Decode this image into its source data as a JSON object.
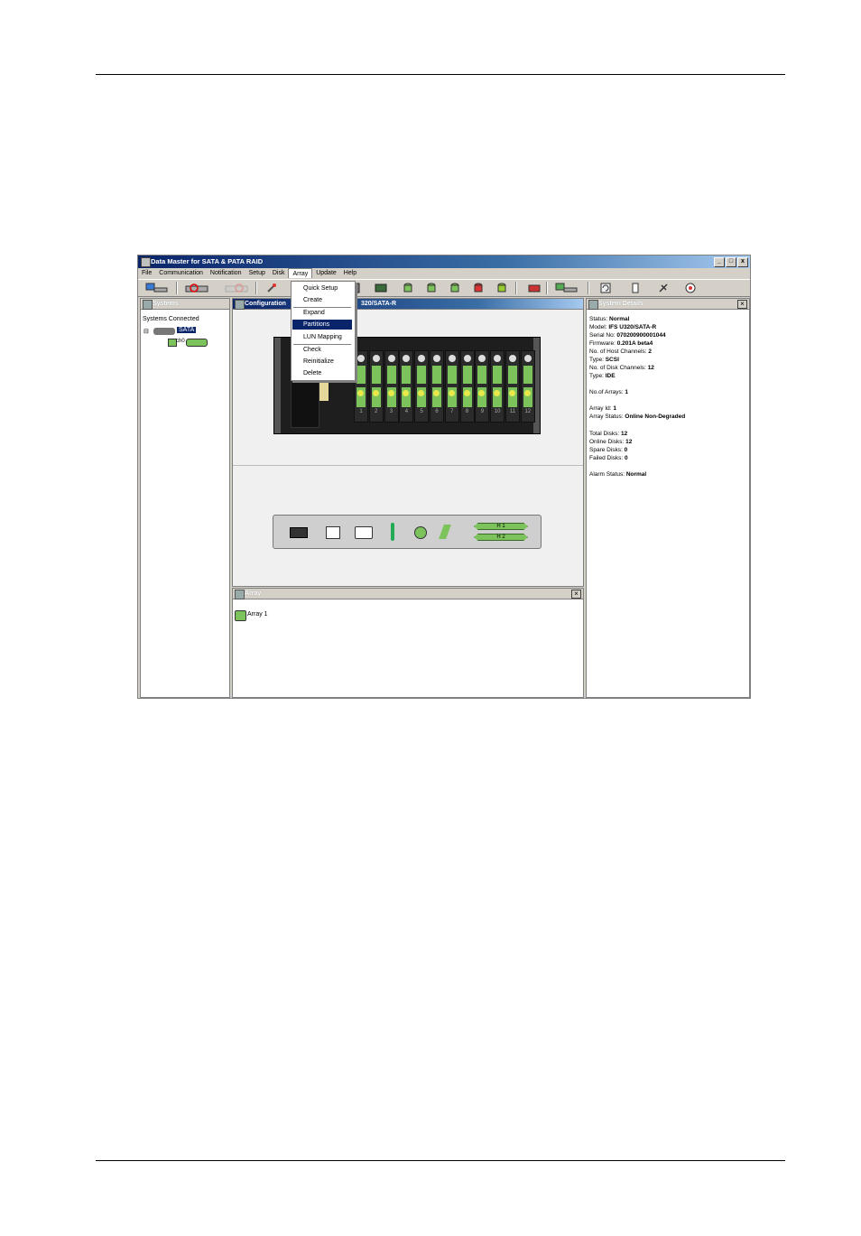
{
  "window": {
    "title": "Data Master for SATA & PATA RAID",
    "min": "_",
    "max": "□",
    "close": "x"
  },
  "menu": [
    "File",
    "Communication",
    "Notification",
    "Setup",
    "Disk",
    "Array",
    "Update",
    "Help"
  ],
  "array_menu": {
    "items": [
      "Quick Setup",
      "Create",
      "Expand",
      "Partitions",
      "LUN Mapping",
      "Check",
      "Reinitialize",
      "Delete"
    ],
    "selected": "Partitions"
  },
  "systems_panel": {
    "title": "Systems",
    "heading": "Systems Connected",
    "node": "SATA",
    "child": "ch0"
  },
  "config_panel": {
    "title": "Configuration",
    "title_suffix": "320/SATA-R"
  },
  "array_panel": {
    "title": "Array",
    "item": "Array 1"
  },
  "enclosure": {
    "bays": [
      "1",
      "2",
      "3",
      "4",
      "5",
      "6",
      "7",
      "8",
      "9",
      "10",
      "11",
      "12"
    ],
    "host_channels": [
      "H 1",
      "H 2"
    ]
  },
  "details_panel": {
    "title": "System Details",
    "lines": [
      {
        "label": "Status:",
        "value": "Normal"
      },
      {
        "label": "Model:",
        "value": "IFS U320/SATA-R"
      },
      {
        "label": "Serial No:",
        "value": "070200900001044"
      },
      {
        "label": "Firmware:",
        "value": "0.201A beta4"
      },
      {
        "label": "No. of Host Channels:",
        "value": "2"
      },
      {
        "label": "Type:",
        "value": "SCSI"
      },
      {
        "label": "No. of Disk Channels:",
        "value": "12"
      },
      {
        "label": "Type:",
        "value": "IDE"
      },
      {
        "label": "No.of Arrays:",
        "value": "1"
      },
      {
        "label": "Array Id:",
        "value": "1"
      },
      {
        "label": "Array Status:",
        "value": "Online Non-Degraded"
      },
      {
        "label": "Total Disks:",
        "value": "12"
      },
      {
        "label": "Online Disks:",
        "value": "12"
      },
      {
        "label": "Spare Disks:",
        "value": "0"
      },
      {
        "label": "Failed Disks:",
        "value": "0"
      },
      {
        "label": "Alarm Status:",
        "value": "Normal"
      }
    ]
  },
  "colors": {
    "title_blue": "#0a246a",
    "disk_green": "#7cc35b",
    "menu_highlight": "#0a246a"
  }
}
